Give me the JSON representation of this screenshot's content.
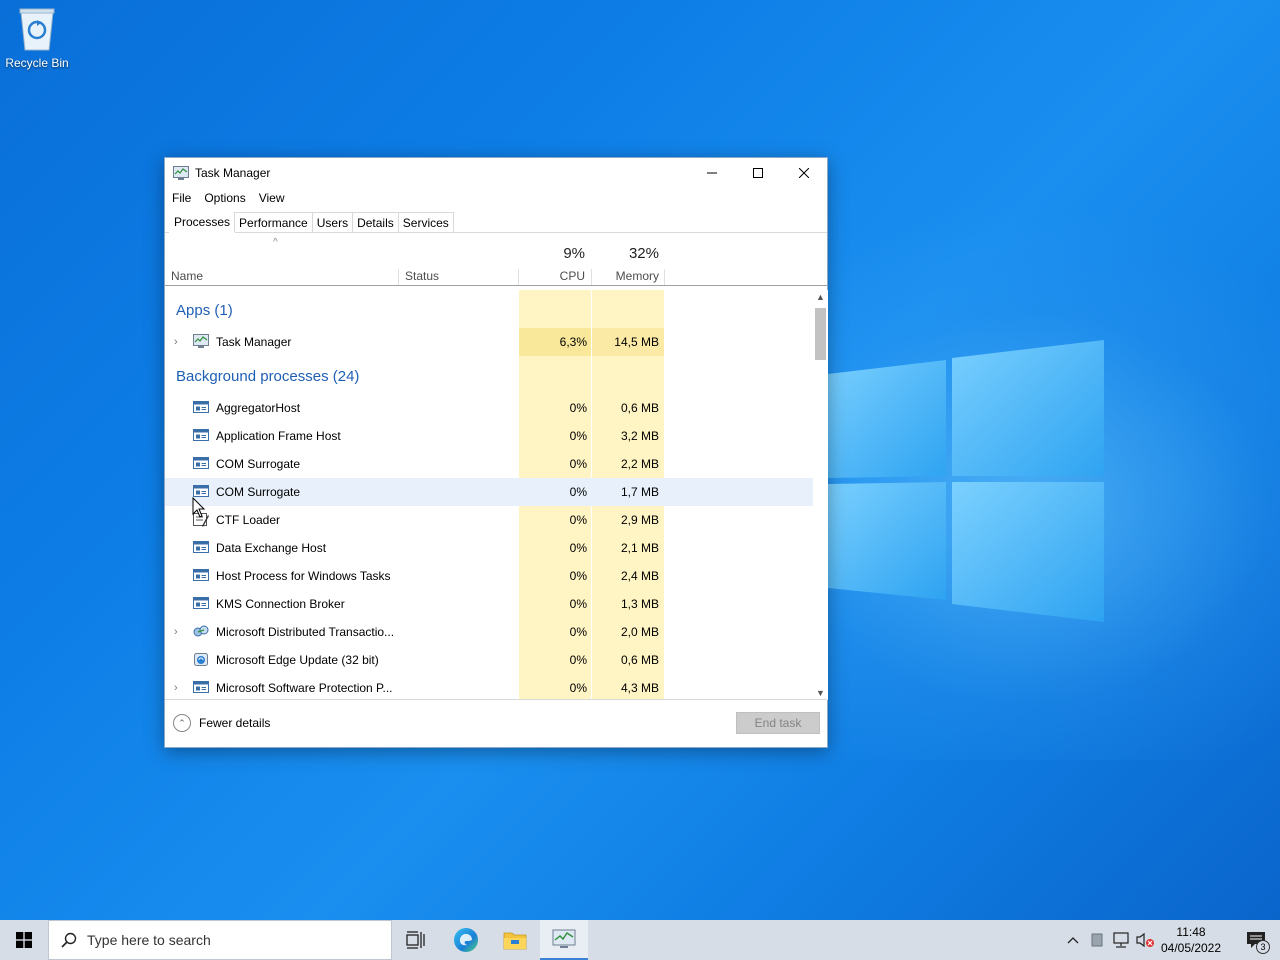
{
  "desktop": {
    "recycle_bin_label": "Recycle Bin"
  },
  "window": {
    "title": "Task Manager",
    "menu": [
      "File",
      "Options",
      "View"
    ],
    "tabs": [
      "Processes",
      "Performance",
      "Users",
      "Details",
      "Services"
    ],
    "active_tab": "Processes"
  },
  "columns": {
    "name": "Name",
    "status": "Status",
    "cpu_pct": "9%",
    "cpu": "CPU",
    "mem_pct": "32%",
    "memory": "Memory"
  },
  "groups": {
    "apps": "Apps (1)",
    "background": "Background processes (24)"
  },
  "apps": [
    {
      "name": "Task Manager",
      "cpu": "6,3%",
      "mem": "14,5 MB",
      "expandable": true,
      "icon": "task-manager-icon"
    }
  ],
  "background": [
    {
      "name": "AggregatorHost",
      "cpu": "0%",
      "mem": "0,6 MB",
      "expandable": false,
      "icon": "process-icon"
    },
    {
      "name": "Application Frame Host",
      "cpu": "0%",
      "mem": "3,2 MB",
      "expandable": false,
      "icon": "process-icon"
    },
    {
      "name": "COM Surrogate",
      "cpu": "0%",
      "mem": "2,2 MB",
      "expandable": false,
      "icon": "process-icon"
    },
    {
      "name": "COM Surrogate",
      "cpu": "0%",
      "mem": "1,7 MB",
      "expandable": false,
      "icon": "process-icon"
    },
    {
      "name": "CTF Loader",
      "cpu": "0%",
      "mem": "2,9 MB",
      "expandable": false,
      "icon": "ctf-loader-icon"
    },
    {
      "name": "Data Exchange Host",
      "cpu": "0%",
      "mem": "2,1 MB",
      "expandable": false,
      "icon": "process-icon"
    },
    {
      "name": "Host Process for Windows Tasks",
      "cpu": "0%",
      "mem": "2,4 MB",
      "expandable": false,
      "icon": "process-icon"
    },
    {
      "name": "KMS Connection Broker",
      "cpu": "0%",
      "mem": "1,3 MB",
      "expandable": false,
      "icon": "process-icon"
    },
    {
      "name": "Microsoft Distributed Transactio...",
      "cpu": "0%",
      "mem": "2,0 MB",
      "expandable": true,
      "icon": "dtc-icon"
    },
    {
      "name": "Microsoft Edge Update (32 bit)",
      "cpu": "0%",
      "mem": "0,6 MB",
      "expandable": false,
      "icon": "edge-update-icon"
    },
    {
      "name": "Microsoft Software Protection P...",
      "cpu": "0%",
      "mem": "4,3 MB",
      "expandable": true,
      "icon": "process-icon"
    }
  ],
  "footer": {
    "fewer_details": "Fewer details",
    "end_task": "End task"
  },
  "taskbar": {
    "search_placeholder": "Type here to search",
    "time": "11:48",
    "date": "04/05/2022",
    "notification_count": "3"
  },
  "colors": {
    "accent": "#1f5fb5",
    "cpu_highlight": "#fff4c4",
    "taskbar": "#d6dde6"
  }
}
